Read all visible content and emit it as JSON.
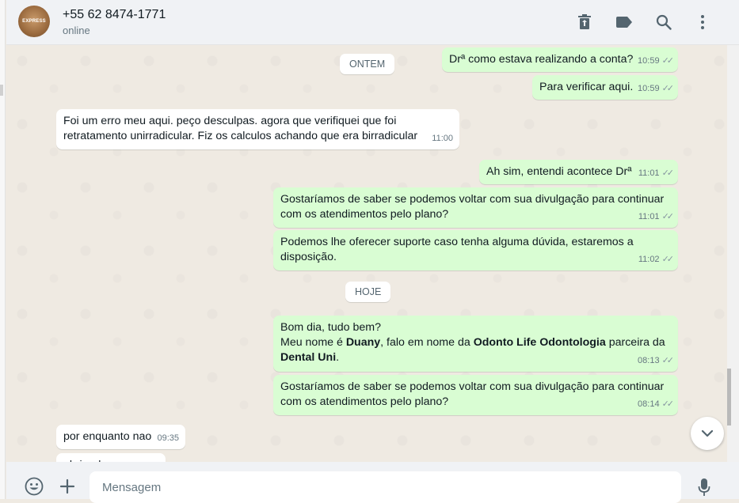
{
  "header": {
    "avatar_text": "EXPRESS",
    "contact_name": "+55 62 8474-1771",
    "status": "online",
    "icons": [
      "trash-icon",
      "label-icon",
      "search-icon",
      "menu-icon"
    ]
  },
  "separators": {
    "yesterday": "ONTEM",
    "today": "HOJE"
  },
  "messages": [
    {
      "dir": "out",
      "text": "Drª como estava realizando a conta?",
      "time": "10:59"
    },
    {
      "dir": "out",
      "text": "Para verificar aqui.",
      "time": "10:59"
    },
    {
      "dir": "in",
      "line1": "Foi um erro meu aqui. peço desculpas. agora que verifiquei que foi",
      "line2": "retratamento unirradicular. Fiz os calculos achando que era birradicular",
      "time": "11:00"
    },
    {
      "dir": "out",
      "text": "Ah sim, entendi acontece Drª",
      "time": "11:01"
    },
    {
      "dir": "out",
      "line1": "Gostaríamos de saber se podemos voltar com sua divulgação para continuar",
      "line2": "com os atendimentos pelo plano?",
      "time": "11:01"
    },
    {
      "dir": "out",
      "line1": "Podemos lhe oferecer suporte caso tenha alguma dúvida, estaremos a",
      "line2": "disposição.",
      "time": "11:02"
    },
    {
      "dir": "out",
      "line1": "Bom dia, tudo bem?",
      "line2_a": "Meu nome é ",
      "line2_b": "Duany",
      "line2_c": ", falo em nome da ",
      "line2_d": "Odonto Life Odontologia",
      "line2_e": " parceira da",
      "line3_a": "Dental Uni",
      "line3_b": ".",
      "time": "08:13"
    },
    {
      "dir": "out",
      "line1": "Gostaríamos de saber se podemos voltar com sua divulgação para continuar",
      "line2": "com os atendimentos pelo plano?",
      "time": "08:14"
    },
    {
      "dir": "in",
      "text": "por enquanto nao",
      "time": "09:35"
    },
    {
      "dir": "in",
      "text": "obrigada",
      "time": ""
    }
  ],
  "footer": {
    "placeholder": "Mensagem",
    "icons": [
      "emoji-icon",
      "plus-icon",
      "microphone-icon"
    ]
  },
  "colors": {
    "outgoing": "#d9fdd3",
    "incoming": "#ffffff",
    "background": "#efeae2",
    "header": "#f0f2f5"
  }
}
